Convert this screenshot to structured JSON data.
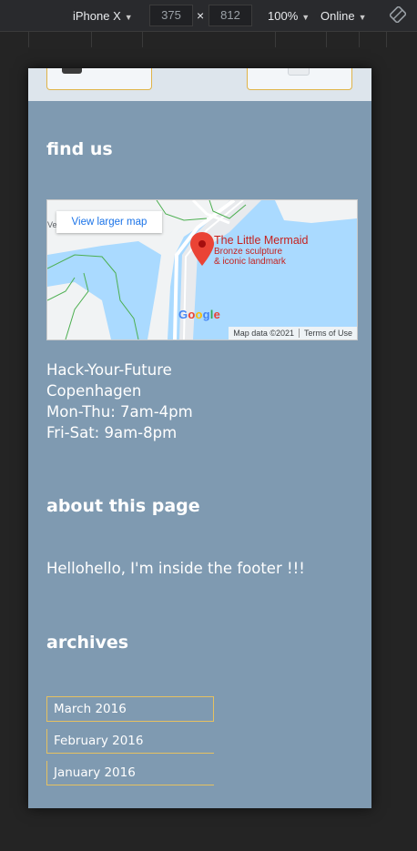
{
  "devtools": {
    "device": "iPhone X",
    "width": "375",
    "height": "812",
    "times_sign": "×",
    "zoom": "100%",
    "network": "Online",
    "rotate_icon": "rotate-icon"
  },
  "footer": {
    "find_us_title": "find us",
    "map": {
      "view_larger_label": "View larger map",
      "place_name": "The Little Mermaid",
      "place_desc_line1": "Bronze sculpture",
      "place_desc_line2": "& iconic landmark",
      "google_logo": [
        "G",
        "o",
        "o",
        "g",
        "l",
        "e"
      ],
      "map_data": "Map data ©2021",
      "terms": "Terms of Use",
      "edge_label": "Ve"
    },
    "address": {
      "line1": "Hack-Your-Future",
      "line2": "Copenhagen",
      "line3": "Mon-Thu: 7am-4pm",
      "line4": "Fri-Sat: 9am-8pm"
    },
    "about_title": "about this page",
    "about_text": "Hellohello, I'm inside the footer !!!",
    "archives_title": "archives",
    "archives": [
      "March 2016",
      "February 2016",
      "January 2016"
    ]
  },
  "colors": {
    "footer_bg": "#7f9ab1",
    "accent_border": "#e6c160",
    "map_water": "#aadaff",
    "map_pin": "#ea4335"
  }
}
